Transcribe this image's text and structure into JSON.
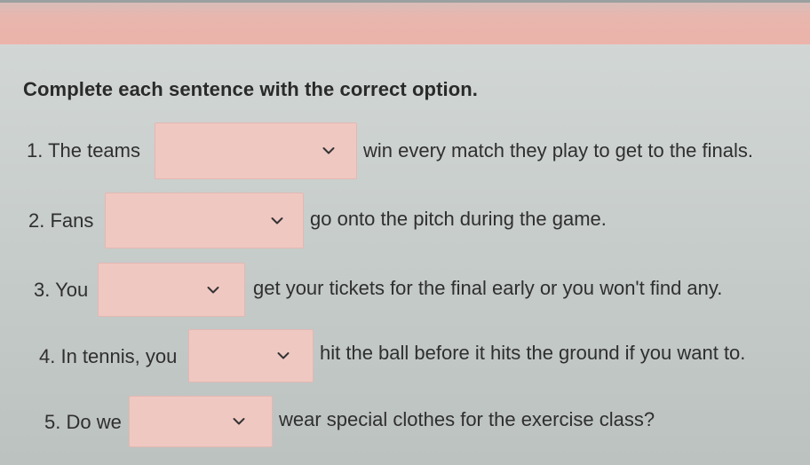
{
  "instruction": "Complete each sentence with the correct option.",
  "sentences": [
    {
      "before": "1. The teams",
      "selected": "",
      "after": "win every match they play to get to the finals."
    },
    {
      "before": "2. Fans",
      "selected": "",
      "after": "go onto the pitch during the game."
    },
    {
      "before": "3. You",
      "selected": "",
      "after": "get your tickets for the final early or you won't find any."
    },
    {
      "before": "4. In tennis, you",
      "selected": "",
      "after": "hit the ball before it hits the ground if you want to."
    },
    {
      "before": "5. Do we",
      "selected": "",
      "after": "wear special clothes for the exercise class?"
    }
  ],
  "icons": {
    "dropdown": "chevron-down-icon"
  },
  "colors": {
    "top_band": "#ebb3aa",
    "dropdown_fill": "#f0c8c2",
    "background": "#c6ccca"
  }
}
